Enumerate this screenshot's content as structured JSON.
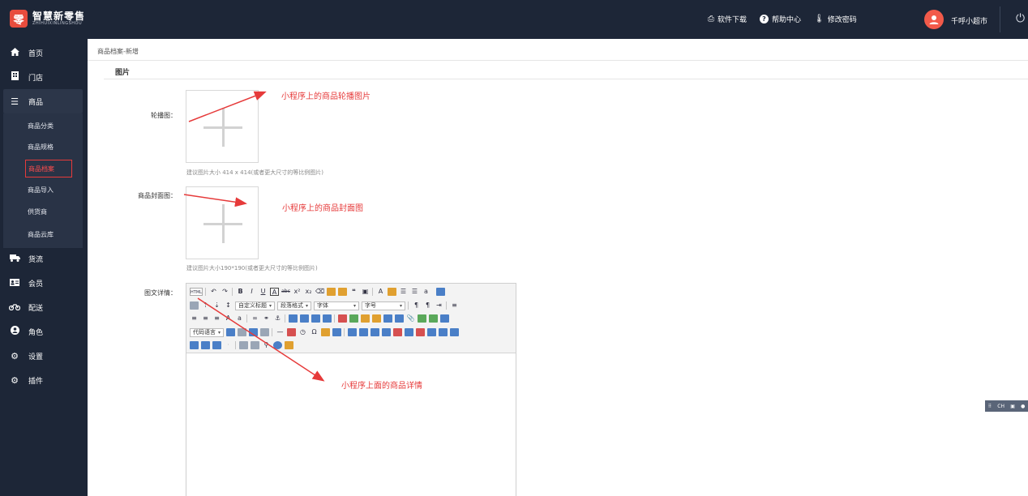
{
  "brand": {
    "logo_glyph": "零",
    "name": "智慧新零售",
    "subtitle": "ZHIHUIXINLINGSHOU"
  },
  "topbar": {
    "links": [
      {
        "icon": "printer-icon",
        "label": "软件下载"
      },
      {
        "icon": "help-icon",
        "label": "帮助中心"
      },
      {
        "icon": "thermometer-icon",
        "label": "修改密码"
      }
    ],
    "user_name": "千呼小超市"
  },
  "sidebar": {
    "items": [
      {
        "icon": "home-icon",
        "label": "首页"
      },
      {
        "icon": "store-icon",
        "label": "门店"
      },
      {
        "icon": "menu-icon",
        "label": "商品"
      },
      {
        "icon": "truck-icon",
        "label": "货流"
      },
      {
        "icon": "member-card-icon",
        "label": "会员"
      },
      {
        "icon": "motorcycle-icon",
        "label": "配送"
      },
      {
        "icon": "user-role-icon",
        "label": "角色"
      },
      {
        "icon": "gear-icon",
        "label": "设置"
      },
      {
        "icon": "plugin-icon",
        "label": "插件"
      }
    ],
    "sub_items": [
      "商品分类",
      "商品规格",
      "商品档案",
      "商品导入",
      "供货商",
      "商品云库"
    ]
  },
  "main": {
    "breadcrumb": "商品档案-新增",
    "section_title": "图片",
    "carousel_label": "轮播图：",
    "carousel_hint": "建议图片大小 414 x 414(或者更大尺寸的等比例图片)",
    "cover_label": "商品封面图：",
    "cover_hint": "建议图片大小190*190(或者更大尺寸的等比例图片)",
    "detail_label": "图文详情："
  },
  "annotations": {
    "carousel_note": "小程序上的商品轮播图片",
    "cover_note": "小程序上的商品封面图",
    "detail_note": "小程序上面的商品详情"
  },
  "editor": {
    "selects": {
      "heading": "自定义标题",
      "paragraph": "段落格式",
      "font": "字体",
      "size": "字号",
      "code": "代码语言"
    }
  },
  "badge": {
    "label": "CH"
  },
  "colors": {
    "sidebar_bg": "#1d2637",
    "accent_red": "#e63a3a",
    "avatar": "#f25a4a"
  }
}
